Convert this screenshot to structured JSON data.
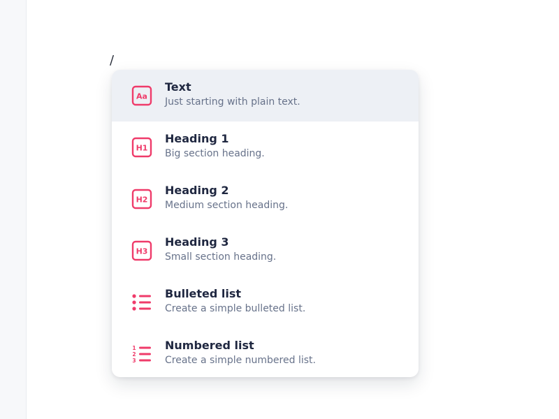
{
  "editor": {
    "slash_command": "/"
  },
  "accent_color": "#ef3b6a",
  "menu": {
    "items": [
      {
        "icon": "text-aa-icon",
        "icon_label": "Aa",
        "title": "Text",
        "description": "Just starting with plain text.",
        "active": true
      },
      {
        "icon": "heading-1-icon",
        "icon_label": "H1",
        "title": "Heading 1",
        "description": "Big section heading.",
        "active": false
      },
      {
        "icon": "heading-2-icon",
        "icon_label": "H2",
        "title": "Heading 2",
        "description": "Medium section heading.",
        "active": false
      },
      {
        "icon": "heading-3-icon",
        "icon_label": "H3",
        "title": "Heading 3",
        "description": "Small section heading.",
        "active": false
      },
      {
        "icon": "bulleted-list-icon",
        "title": "Bulleted list",
        "description": "Create a simple bulleted list.",
        "active": false
      },
      {
        "icon": "numbered-list-icon",
        "title": "Numbered list",
        "description": "Create a simple numbered list.",
        "active": false
      }
    ]
  }
}
